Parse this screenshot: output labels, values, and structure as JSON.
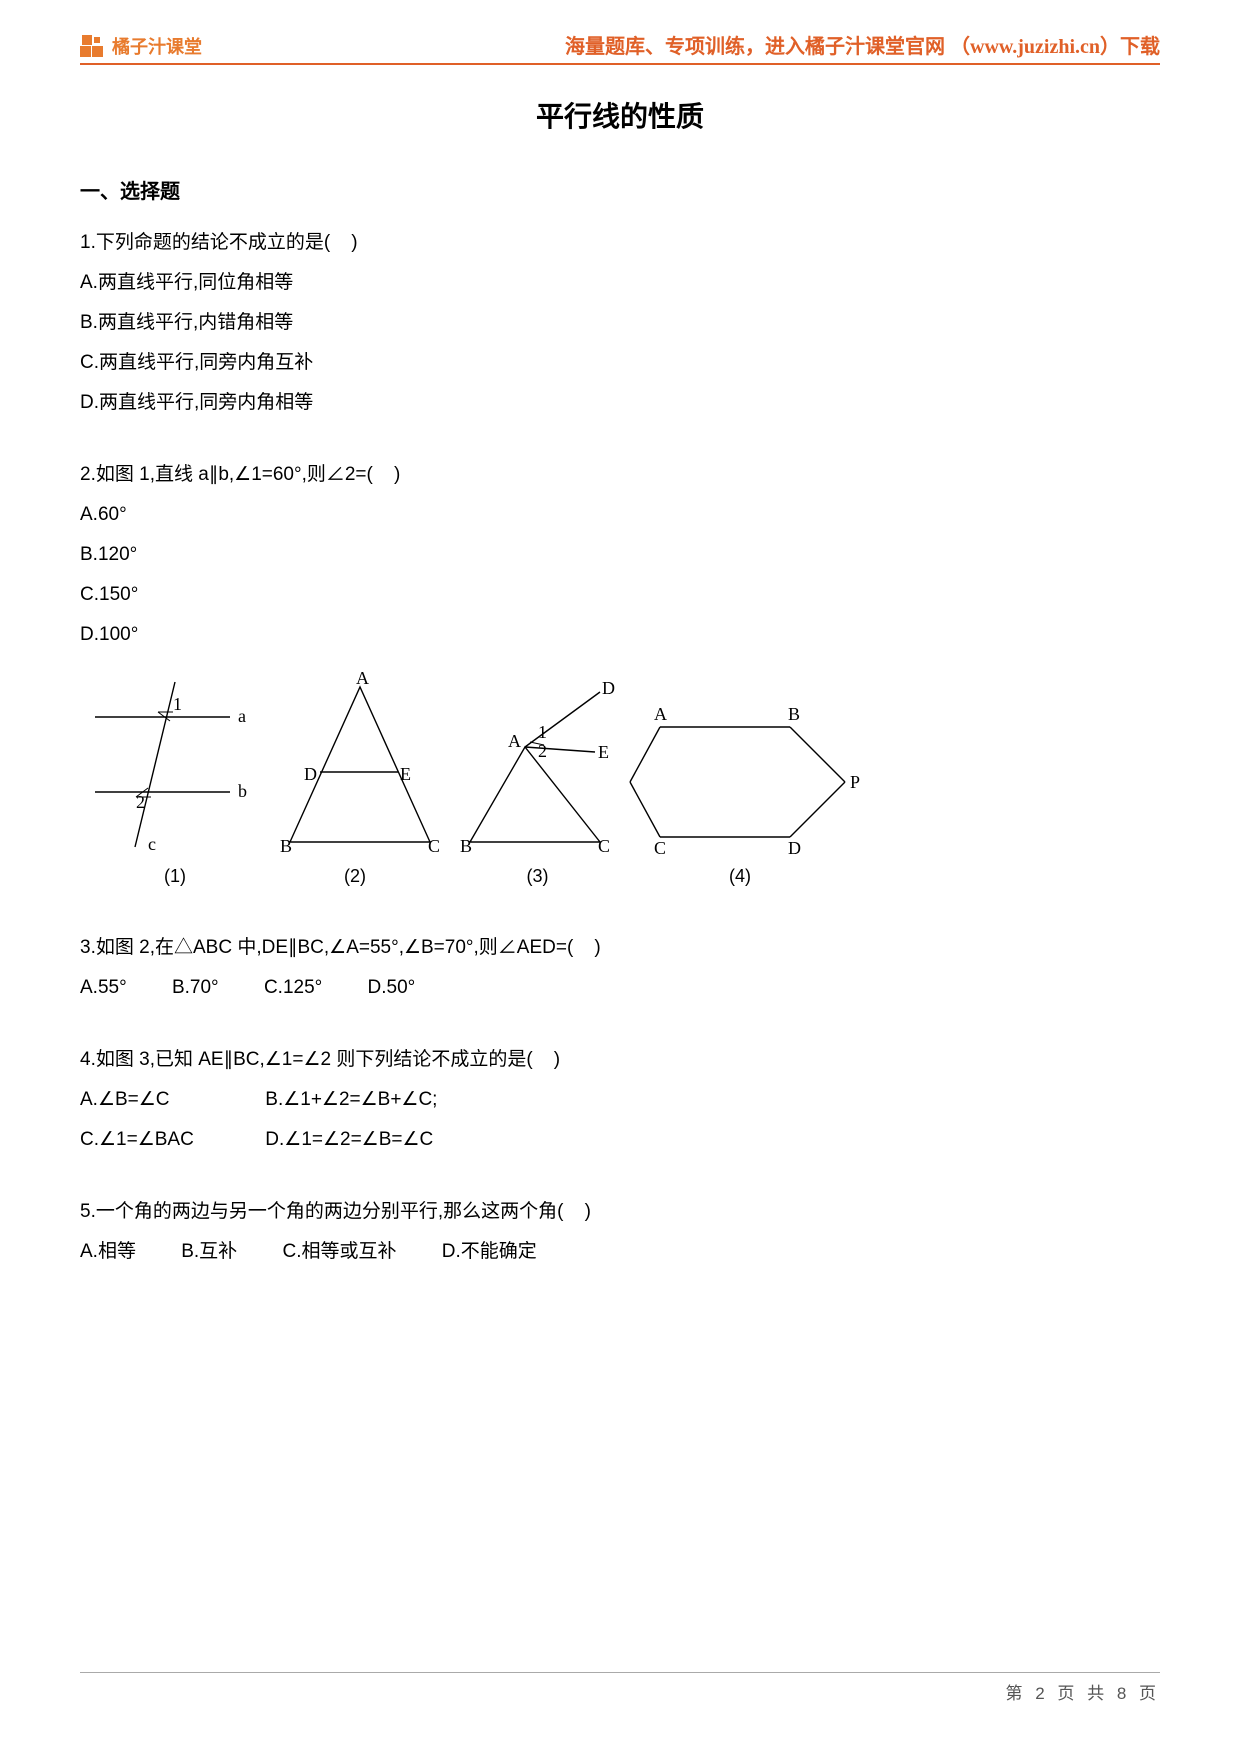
{
  "header": {
    "logo_text": "橘子汁课堂",
    "tagline": "海量题库、专项训练，进入橘子汁课堂官网 （www.juzizhi.cn）下载"
  },
  "title": "平行线的性质",
  "section1_header": "一、选择题",
  "q1": {
    "stem": "1.下列命题的结论不成立的是(    )",
    "A": "A.两直线平行,同位角相等",
    "B": "B.两直线平行,内错角相等",
    "C": "C.两直线平行,同旁内角互补",
    "D": "D.两直线平行,同旁内角相等"
  },
  "q2": {
    "stem": "2.如图 1,直线 a∥b,∠1=60°,则∠2=(    )",
    "A": "A.60°",
    "B": "B.120°",
    "C": "C.150°",
    "D": "D.100°"
  },
  "figures": {
    "f1": "(1)",
    "f2": "(2)",
    "f3": "(3)",
    "f4": "(4)",
    "labels": {
      "a": "a",
      "b": "b",
      "c": "c",
      "A": "A",
      "B": "B",
      "C": "C",
      "D": "D",
      "E": "E",
      "P": "P",
      "ang1": "1",
      "ang2": "2"
    }
  },
  "q3": {
    "stem": "3.如图 2,在△ABC 中,DE∥BC,∠A=55°,∠B=70°,则∠AED=(    )",
    "A": "A.55°",
    "B": "B.70°",
    "C": "C.125°",
    "D": "D.50°"
  },
  "q4": {
    "stem": "4.如图 3,已知 AE∥BC,∠1=∠2 则下列结论不成立的是(    )",
    "row1_A": "A.∠B=∠C",
    "row1_B": "B.∠1+∠2=∠B+∠C;",
    "row2_C": "C.∠1=∠BAC",
    "row2_D": "D.∠1=∠2=∠B=∠C"
  },
  "q5": {
    "stem": "5.一个角的两边与另一个角的两边分别平行,那么这两个角(    )",
    "A": "A.相等",
    "B": "B.互补",
    "C": "C.相等或互补",
    "D": "D.不能确定"
  },
  "footer": "第 2 页 共 8 页"
}
